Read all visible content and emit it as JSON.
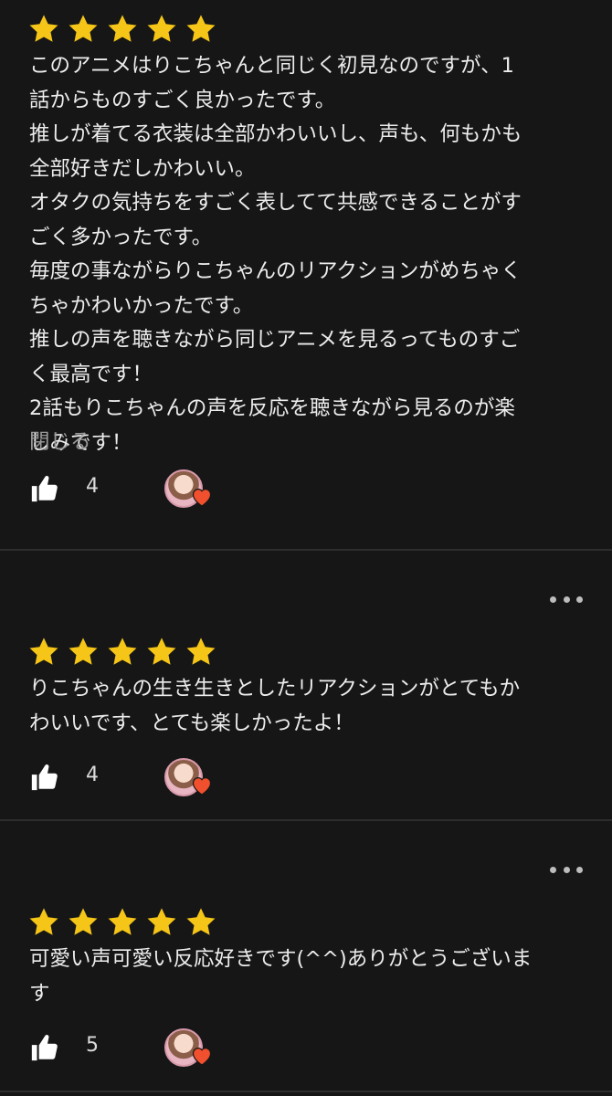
{
  "reviews": [
    {
      "rating": 5,
      "text": "このアニメはりこちゃんと同じく初見なのですが、1\n話からものすごく良かったです。\n推しが着てる衣装は全部かわいいし、声も、何もかも\n全部好きだしかわいい。\nオタクの気持ちをすごく表してて共感できることがす\nごく多かったです。\n毎度の事ながらりこちゃんのリアクションがめちゃく\nちゃかわいかったです。\n推しの声を聴きながら同じアニメを見るってものすご\nく最高です！\n2話もりこちゃんの声を反応を聴きながら見るのが楽\nしみです！",
      "toggle_label": "閉じる",
      "likes": "4"
    },
    {
      "rating": 5,
      "text": "りこちゃんの生き生きとしたリアクションがとてもか\nわいいです、とても楽しかったよ！",
      "likes": "4"
    },
    {
      "rating": 5,
      "text": "可愛い声可愛い反応好きです(^^)ありがとうございま\nす",
      "likes": "5"
    }
  ],
  "icons": {
    "star": "star-icon",
    "more": "more-options-icon",
    "like": "thumbs-up-icon",
    "heart": "heart-icon"
  },
  "colors": {
    "background": "#161616",
    "star": "#f5c518",
    "heart": "#f0502d",
    "text": "#ececec",
    "muted": "#9a9a9a"
  }
}
